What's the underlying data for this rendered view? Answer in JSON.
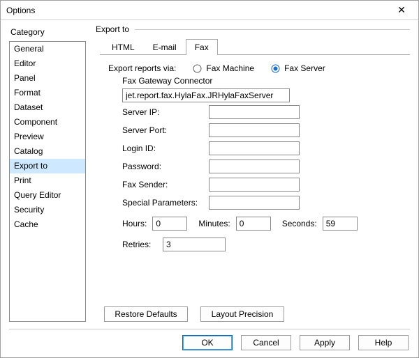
{
  "window": {
    "title": "Options"
  },
  "category_label": "Category",
  "categories": [
    "General",
    "Editor",
    "Panel",
    "Format",
    "Dataset",
    "Component",
    "Preview",
    "Catalog",
    "Export to",
    "Print",
    "Query Editor",
    "Security",
    "Cache"
  ],
  "selected_category_index": 8,
  "main": {
    "heading": "Export to",
    "tabs": [
      "HTML",
      "E-mail",
      "Fax"
    ],
    "active_tab_index": 2
  },
  "fax": {
    "via_label": "Export reports via:",
    "radio_machine": "Fax Machine",
    "radio_server": "Fax Server",
    "selected": "server",
    "gateway_label": "Fax Gateway Connector",
    "gateway_value": "jet.report.fax.HylaFax.JRHylaFaxServer",
    "fields": {
      "server_ip": {
        "label": "Server IP:",
        "value": ""
      },
      "server_port": {
        "label": "Server Port:",
        "value": ""
      },
      "login_id": {
        "label": "Login ID:",
        "value": ""
      },
      "password": {
        "label": "Password:",
        "value": ""
      },
      "fax_sender": {
        "label": "Fax Sender:",
        "value": ""
      },
      "special": {
        "label": "Special Parameters:",
        "value": ""
      }
    },
    "time": {
      "hours_label": "Hours:",
      "hours": "0",
      "minutes_label": "Minutes:",
      "minutes": "0",
      "seconds_label": "Seconds:",
      "seconds": "59"
    },
    "retries_label": "Retries:",
    "retries": "3"
  },
  "mid_buttons": {
    "restore": "Restore Defaults",
    "layout": "Layout Precision"
  },
  "footer": {
    "ok": "OK",
    "cancel": "Cancel",
    "apply": "Apply",
    "help": "Help"
  }
}
